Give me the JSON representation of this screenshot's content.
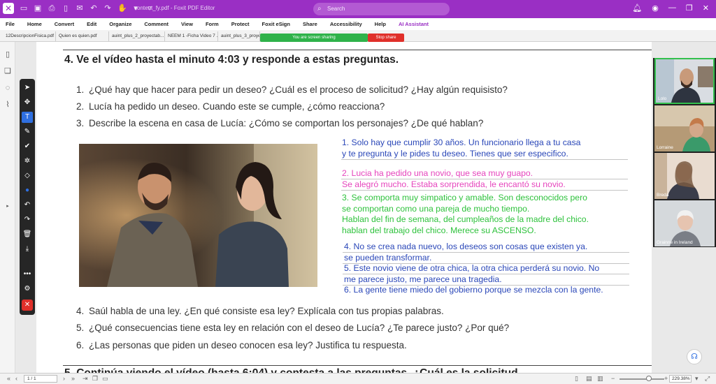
{
  "window": {
    "file_title": "content_fy.pdf - Foxit PDF Editor",
    "search_placeholder": "Search"
  },
  "menu": [
    "File",
    "Home",
    "Convert",
    "Edit",
    "Organize",
    "Comment",
    "View",
    "Form",
    "Protect",
    "Foxit eSign",
    "Share",
    "Accessibility",
    "Help",
    "AI Assistant"
  ],
  "tabs": [
    "12DescripcionFisica.pdf",
    "Quien es quien.pdf",
    "auint_plus_2_proyectab...",
    "NEEM 1 -Ficha Video 7 ...",
    "auint_plus_3_proyec"
  ],
  "sharing": {
    "banner": "You are screen sharing",
    "stop": "Stop share"
  },
  "document": {
    "heading": "4. Ve el vídeo hasta el minuto 4:03 y responde a estas preguntas.",
    "questions_top": [
      {
        "num": "1.",
        "text": "¿Qué hay que hacer para pedir un deseo? ¿Cuál es el proceso de solicitud? ¿Hay algún requisisto?"
      },
      {
        "num": "2.",
        "text": "Lucía ha pedido un deseo. Cuando este se cumple, ¿cómo reacciona?"
      },
      {
        "num": "3.",
        "text": "Describe la escena en casa de Lucía: ¿Cómo se comportan los personajes? ¿De qué hablan?"
      }
    ],
    "questions_bottom": [
      {
        "num": "4.",
        "text": "Saúl habla de una ley. ¿En qué consiste esa ley? Explícala con tus propias palabras."
      },
      {
        "num": "5.",
        "text": "¿Qué consecuencias tiene esta ley en relación con el deseo de Lucía? ¿Te parece justo? ¿Por qué?"
      },
      {
        "num": "6.",
        "text": "¿Las personas que piden un deseo conocen esa ley? Justifica tu respuesta."
      }
    ],
    "next_heading": "5. Continúa viendo el vídeo (hasta 6:04) y contesta a las preguntas. ¿Cuál es la solicitud...",
    "answers": {
      "a1": [
        "1. Solo hay que cumplir 30 años. Un funcionario llega a tu casa",
        "y te pregunta y le pides tu deseo. Tienes que ser especifico."
      ],
      "a2": [
        "2. Lucia ha pedido una novio, que sea muy guapo.",
        "Se alegró mucho. Estaba sorprendida, le encantó su novio."
      ],
      "a3": [
        "3. Se comporta muy simpatico y amable. Son desconocidos pero",
        "se comportan como una pareja de mucho tiempo.",
        "Hablan del fin de semana, del cumpleaños de la madre del chico.",
        "hablan del trabajo del chico. Merece su ASCENSO."
      ],
      "a4": [
        "4. No se crea nada nuevo, los deseos son cosas que existen ya.",
        "se pueden transformar."
      ],
      "a5": [
        "5. Este novio viene de otra chica, la otra chica perderá su novio. No",
        "me parece justo, me parece una tragedia."
      ],
      "a6": [
        "6. La gente tiene miedo del gobierno porque se mezcla con la gente."
      ]
    }
  },
  "participants": [
    "Lolo",
    "Lorraine",
    "Breda",
    "Grainne in Ireland"
  ],
  "status": {
    "page": "1 / 1",
    "zoom": "229.38%"
  }
}
